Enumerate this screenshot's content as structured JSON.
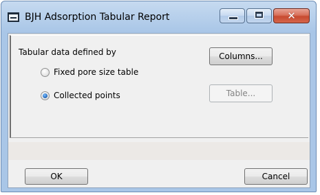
{
  "window": {
    "title": "BJH Adsorption Tabular Report"
  },
  "caption_buttons": {
    "minimize_icon": "minimize-icon",
    "maximize_icon": "maximize-icon",
    "close_glyph": "✕"
  },
  "group": {
    "label": "Tabular data defined by",
    "options": [
      {
        "label": "Fixed pore size table",
        "checked": false
      },
      {
        "label": "Collected points",
        "checked": true
      }
    ]
  },
  "buttons": {
    "columns": "Columns...",
    "table": "Table...",
    "ok": "OK",
    "cancel": "Cancel"
  },
  "colors": {
    "accent": "#2b6fc0",
    "close": "#c74a30"
  }
}
